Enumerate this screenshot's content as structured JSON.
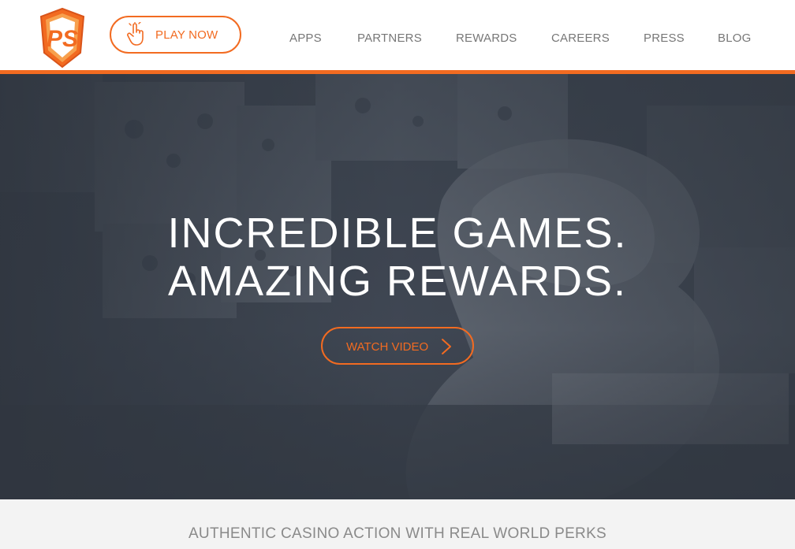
{
  "header": {
    "logo": {
      "icon": "playstudios-logo-icon",
      "text": "PS"
    },
    "play_button": {
      "label": "PLAY NOW",
      "icon": "hand-pointer-icon"
    },
    "nav": [
      {
        "label": "APPS"
      },
      {
        "label": "PARTNERS"
      },
      {
        "label": "REWARDS"
      },
      {
        "label": "CAREERS"
      },
      {
        "label": "PRESS"
      },
      {
        "label": "BLOG"
      }
    ]
  },
  "hero": {
    "title_line1": "INCREDIBLE GAMES.",
    "title_line2": "AMAZING REWARDS.",
    "watch_button": {
      "label": "WATCH VIDEO",
      "icon": "chevron-right-icon"
    }
  },
  "strip": {
    "tagline": "AUTHENTIC CASINO ACTION WITH REAL WORLD PERKS"
  },
  "colors": {
    "accent": "#f26b21",
    "nav_text": "#777777",
    "hero_overlay": "#3e4550",
    "strip_bg": "#f3f3f3"
  }
}
